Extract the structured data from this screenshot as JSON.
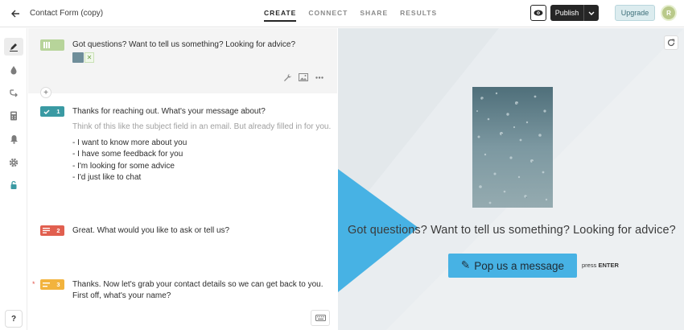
{
  "header": {
    "form_title": "Contact Form (copy)",
    "tabs": [
      {
        "label": "CREATE",
        "active": true
      },
      {
        "label": "CONNECT",
        "active": false
      },
      {
        "label": "SHARE",
        "active": false
      },
      {
        "label": "RESULTS",
        "active": false
      }
    ],
    "publish_label": "Publish",
    "upgrade_label": "Upgrade",
    "avatar_initial": "R"
  },
  "sidebar": {
    "help_label": "?",
    "icons": [
      "pencil-icon",
      "drop-icon",
      "branch-icon",
      "calculator-icon",
      "bell-icon",
      "gear-icon",
      "lock-icon"
    ]
  },
  "editor": {
    "welcome": {
      "text": "Got questions? Want to tell us something? Looking for advice?",
      "thumb_remove": "✕",
      "badge_color": "#b7d49a"
    },
    "add_label": "+",
    "questions": [
      {
        "number": "1",
        "color": "#3a9aa3",
        "icon": "check-icon",
        "text": "Thanks for reaching out. What's your message about?",
        "description": "Think of this like the subject field in an email. But already filled in for you.",
        "choices": [
          "- I want to know more about you",
          "- I have some feedback for you",
          "- I'm looking for some advice",
          "- I'd just like to chat"
        ]
      },
      {
        "number": "2",
        "color": "#e15f4f",
        "icon": "long-text-icon",
        "text": "Great. What would you like to ask or tell us?"
      },
      {
        "number": "3",
        "color": "#f2b33d",
        "icon": "short-text-icon",
        "required_marker": "*",
        "text_line1": "Thanks. Now let's grab your contact details so we can get back to you.",
        "text_line2": "First off, what's your name?"
      }
    ]
  },
  "preview": {
    "question": "Got questions? Want to tell us something? Looking for advice?",
    "button_icon": "✎",
    "button_label": "Pop us a message",
    "hint_prefix": "press",
    "hint_key": "ENTER",
    "accent_color": "#47b2e4"
  }
}
